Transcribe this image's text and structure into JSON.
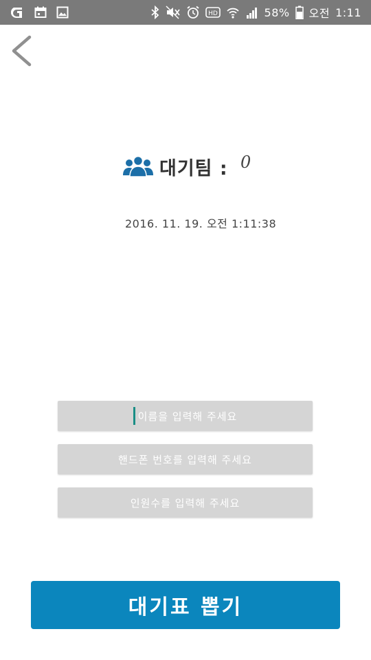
{
  "status_bar": {
    "battery": "58%",
    "ampm": "오전",
    "time": "1:11",
    "hd_label": "HD"
  },
  "main": {
    "waiting_label": "대기팀 :",
    "waiting_count": "0",
    "datetime": "2016. 11. 19. 오전 1:11:38"
  },
  "form": {
    "name_placeholder": "이름을 입력해 주세요",
    "phone_placeholder": "핸드폰 번호를 입력해 주세요",
    "people_placeholder": "인원수를 입력해 주세요"
  },
  "action": {
    "ticket_label": "대기표 뽑기"
  },
  "colors": {
    "status_bar": "#7a7a7a",
    "accent": "#0b86bd",
    "team_icon": "#1c6fa8",
    "input_bg": "#d5d5d5",
    "caret": "#1a8e86"
  },
  "icons": {
    "back": "chevron-left-icon",
    "team": "group-icon"
  }
}
